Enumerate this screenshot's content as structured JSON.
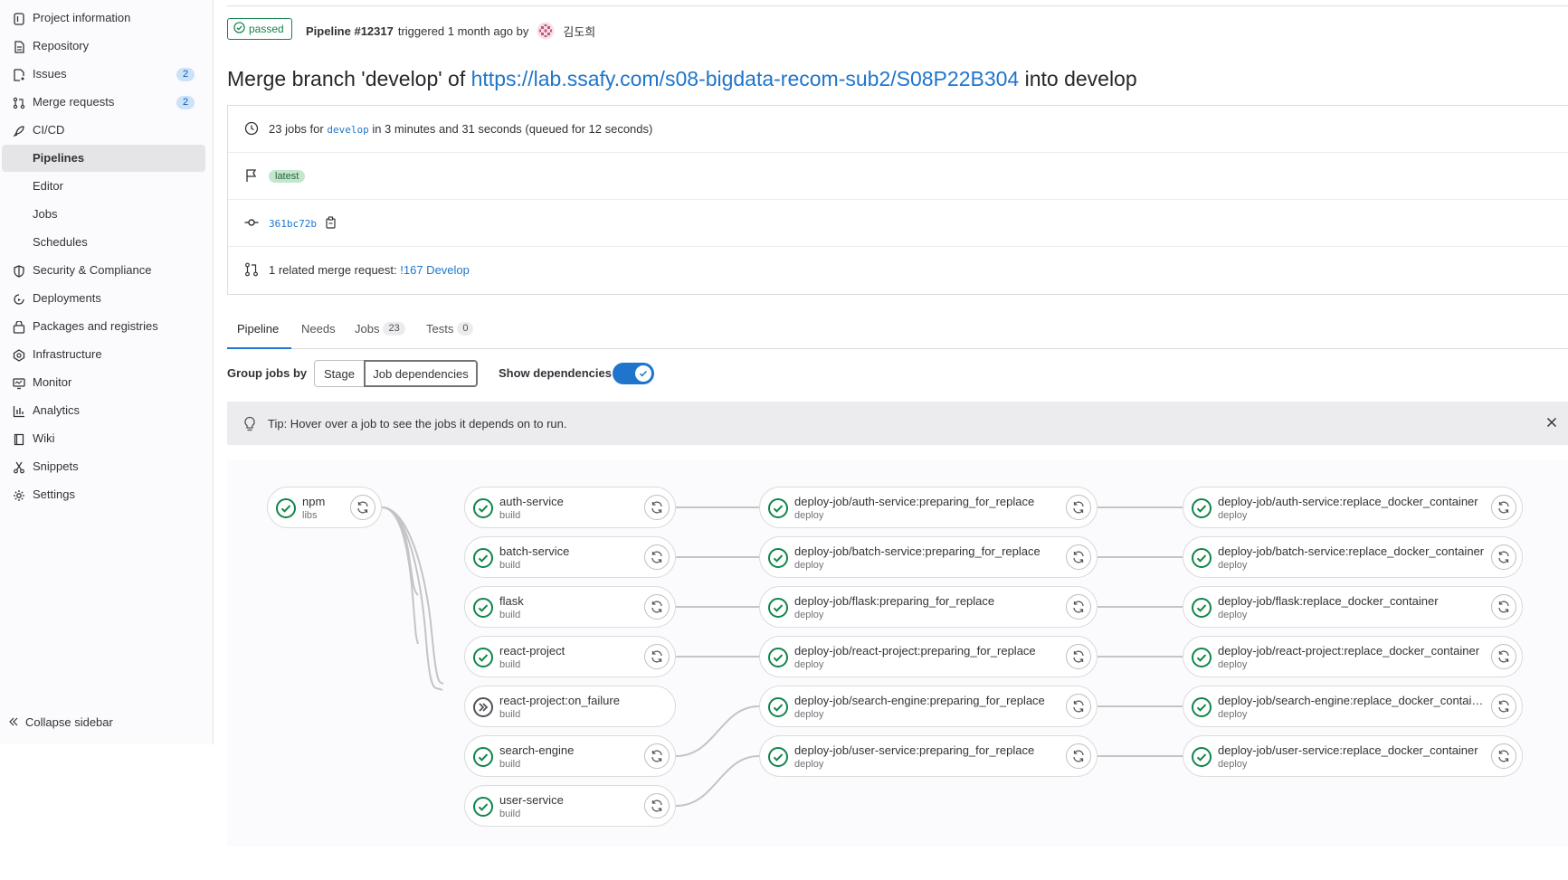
{
  "sidebar": {
    "items": [
      {
        "label": "Project information",
        "icon": "info-icon"
      },
      {
        "label": "Repository",
        "icon": "document-icon"
      },
      {
        "label": "Issues",
        "icon": "issues-icon",
        "count": "2"
      },
      {
        "label": "Merge requests",
        "icon": "merge-request-icon",
        "count": "2"
      },
      {
        "label": "CI/CD",
        "icon": "rocket-icon"
      },
      {
        "label": "Pipelines",
        "active": true
      },
      {
        "label": "Editor"
      },
      {
        "label": "Jobs"
      },
      {
        "label": "Schedules"
      },
      {
        "label": "Security & Compliance",
        "icon": "shield-icon"
      },
      {
        "label": "Deployments",
        "icon": "deployments-icon"
      },
      {
        "label": "Packages and registries",
        "icon": "package-icon"
      },
      {
        "label": "Infrastructure",
        "icon": "cloud-icon"
      },
      {
        "label": "Monitor",
        "icon": "monitor-icon"
      },
      {
        "label": "Analytics",
        "icon": "chart-icon"
      },
      {
        "label": "Wiki",
        "icon": "book-icon"
      },
      {
        "label": "Snippets",
        "icon": "scissors-icon"
      },
      {
        "label": "Settings",
        "icon": "gear-icon"
      }
    ],
    "collapse_label": "Collapse sidebar"
  },
  "header": {
    "status": "passed",
    "pipeline_label": "Pipeline #12317",
    "triggered_text": "triggered 1 month ago by",
    "author": "김도희",
    "title_prefix": "Merge branch 'develop' of",
    "title_link": "https://lab.ssafy.com/s08-bigdata-recom-sub2/S08P22B304",
    "title_suffix": "into develop"
  },
  "info": {
    "jobs_text_prefix": "23 jobs for",
    "branch": "develop",
    "jobs_text_suffix": "in 3 minutes and 31 seconds (queued for 12 seconds)",
    "tag": "latest",
    "commit_sha": "361bc72b",
    "mr_prefix": "1 related merge request:",
    "mr_link": "!167 Develop"
  },
  "tabs": [
    {
      "label": "Pipeline",
      "active": true
    },
    {
      "label": "Needs"
    },
    {
      "label": "Jobs",
      "count": "23"
    },
    {
      "label": "Tests",
      "count": "0"
    }
  ],
  "controls": {
    "group_label": "Group jobs by",
    "stage_button": "Stage",
    "jobs_button": "Job dependencies",
    "show_deps_label": "Show dependencies",
    "show_deps_on": true
  },
  "tip": {
    "text": "Tip: Hover over a job to see the jobs it depends on to run."
  },
  "jobs": {
    "col0": [
      {
        "name": "npm",
        "stage": "libs",
        "status": "passed"
      }
    ],
    "col1": [
      {
        "name": "auth-service",
        "stage": "build",
        "status": "passed"
      },
      {
        "name": "batch-service",
        "stage": "build",
        "status": "passed"
      },
      {
        "name": "flask",
        "stage": "build",
        "status": "passed"
      },
      {
        "name": "react-project",
        "stage": "build",
        "status": "passed"
      },
      {
        "name": "react-project:on_failure",
        "stage": "build",
        "status": "skipped"
      },
      {
        "name": "search-engine",
        "stage": "build",
        "status": "passed"
      },
      {
        "name": "user-service",
        "stage": "build",
        "status": "passed"
      }
    ],
    "col2": [
      {
        "name": "deploy-job/auth-service:preparing_for_replace",
        "stage": "deploy",
        "status": "passed"
      },
      {
        "name": "deploy-job/batch-service:preparing_for_replace",
        "stage": "deploy",
        "status": "passed"
      },
      {
        "name": "deploy-job/flask:preparing_for_replace",
        "stage": "deploy",
        "status": "passed"
      },
      {
        "name": "deploy-job/react-project:preparing_for_replace",
        "stage": "deploy",
        "status": "passed"
      },
      {
        "name": "deploy-job/search-engine:preparing_for_replace",
        "stage": "deploy",
        "status": "passed"
      },
      {
        "name": "deploy-job/user-service:preparing_for_replace",
        "stage": "deploy",
        "status": "passed"
      }
    ],
    "col3": [
      {
        "name": "deploy-job/auth-service:replace_docker_container",
        "stage": "deploy",
        "status": "passed"
      },
      {
        "name": "deploy-job/batch-service:replace_docker_container",
        "stage": "deploy",
        "status": "passed"
      },
      {
        "name": "deploy-job/flask:replace_docker_container",
        "stage": "deploy",
        "status": "passed"
      },
      {
        "name": "deploy-job/react-project:replace_docker_container",
        "stage": "deploy",
        "status": "passed"
      },
      {
        "name": "deploy-job/search-engine:replace_docker_contain...",
        "stage": "deploy",
        "status": "passed"
      },
      {
        "name": "deploy-job/user-service:replace_docker_container",
        "stage": "deploy",
        "status": "passed"
      }
    ]
  },
  "colors": {
    "success": "#108548",
    "link": "#1f75cb",
    "skipped": "#535158"
  }
}
